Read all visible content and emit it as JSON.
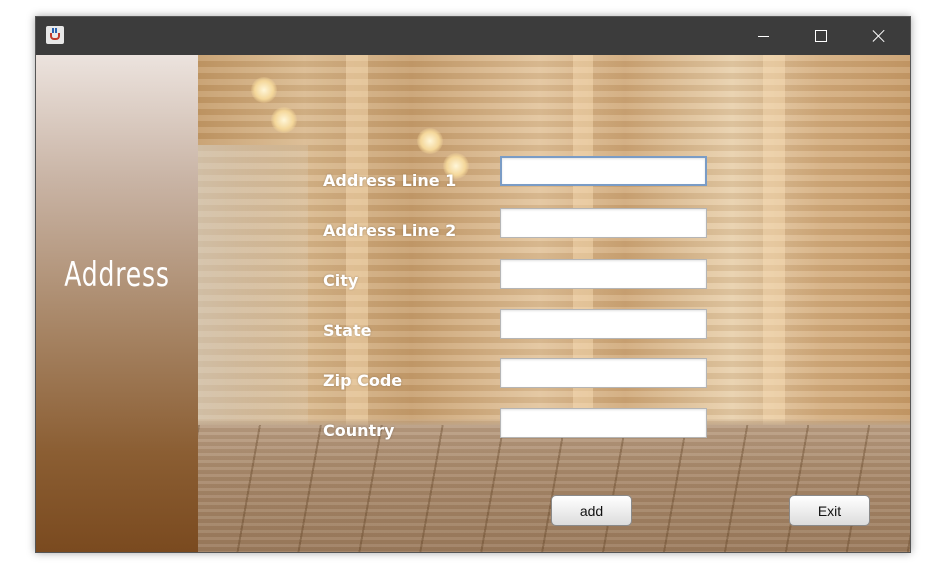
{
  "window": {
    "title": "",
    "app_icon": "java-coffee-cup-icon",
    "controls": [
      "minimize-icon",
      "maximize-icon",
      "close-icon"
    ]
  },
  "sidebar": {
    "title": "Address"
  },
  "form": {
    "fields": [
      {
        "label": "Address Line 1",
        "value": ""
      },
      {
        "label": "Address Line 2",
        "value": ""
      },
      {
        "label": "City",
        "value": ""
      },
      {
        "label": "State",
        "value": ""
      },
      {
        "label": "Zip Code",
        "value": ""
      },
      {
        "label": "Country",
        "value": ""
      }
    ]
  },
  "buttons": {
    "add_label": "add",
    "exit_label": "Exit"
  },
  "colors": {
    "titlebar": "#3c3c3c",
    "sidebar_top": "#ece3de",
    "sidebar_bottom": "#7a4a1f",
    "label_text": "#ffffff",
    "focus_border": "#7a9cc6"
  }
}
